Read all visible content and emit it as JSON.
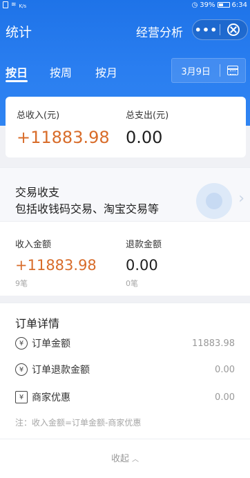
{
  "status_bar": {
    "speed_unit": "K/s",
    "battery": "39%",
    "time": "6:34"
  },
  "nav": {
    "title": "统计",
    "shop": "经营分析",
    "more": "•••"
  },
  "tabs": [
    {
      "label": "按日"
    },
    {
      "label": "按周"
    },
    {
      "label": "按月"
    }
  ],
  "date": {
    "label": "3月9日"
  },
  "summary": {
    "income_label": "总收入(元)",
    "income_value": "+11883.98",
    "expense_label": "总支出(元)",
    "expense_value": "0.00"
  },
  "transactions": {
    "title": "交易收支",
    "subtitle": "包括收钱码交易、淘宝交易等",
    "income_label": "收入金额",
    "income_value": "+11883.98",
    "income_count": "9笔",
    "refund_label": "退款金额",
    "refund_value": "0.00",
    "refund_count": "0笔"
  },
  "order_detail": {
    "title": "订单详情",
    "rows": [
      {
        "icon": "¥",
        "label": "订单金额",
        "value": "11883.98"
      },
      {
        "icon": "¥",
        "label": "订单退款金额",
        "value": "0.00"
      },
      {
        "icon": "¥",
        "label": "商家优惠",
        "value": "0.00"
      }
    ],
    "note": "注：收入金额=订单金额-商家优惠",
    "collapse": "收起"
  },
  "colors": {
    "brand_blue": "#1e73e8",
    "income_orange": "#d86c2a"
  }
}
